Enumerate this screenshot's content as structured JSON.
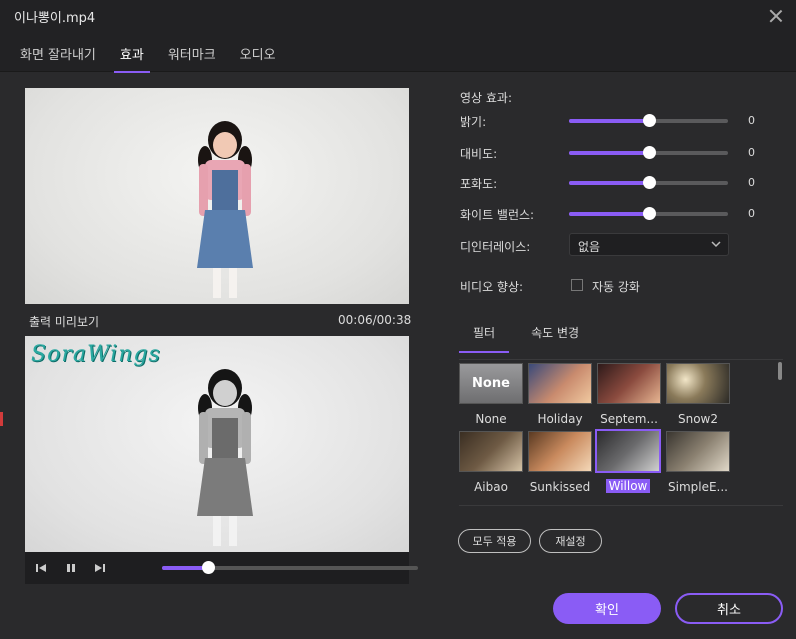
{
  "window": {
    "title": "이나뽕이.mp4"
  },
  "tabs": [
    {
      "label": "화면 잘라내기",
      "active": false
    },
    {
      "label": "효과",
      "active": true
    },
    {
      "label": "워터마크",
      "active": false
    },
    {
      "label": "오디오",
      "active": false
    }
  ],
  "preview": {
    "output_label": "출력 미리보기",
    "time": "00:06/00:38",
    "watermark_text": "SoraWings",
    "playback_progress": 0.18
  },
  "effects": {
    "section_title": "영상 효과:",
    "sliders": [
      {
        "label": "밝기:",
        "value": "0",
        "position": 0.5
      },
      {
        "label": "대비도:",
        "value": "0",
        "position": 0.5
      },
      {
        "label": "포화도:",
        "value": "0",
        "position": 0.5
      },
      {
        "label": "화이트 밸런스:",
        "value": "0",
        "position": 0.5
      }
    ],
    "deinterlace_label": "디인터레이스:",
    "deinterlace_value": "없음",
    "enhance_label": "비디오 향상:",
    "enhance_checkbox_label": "자동 강화",
    "enhance_checked": false
  },
  "filter_tabs": [
    {
      "label": "필터",
      "active": true
    },
    {
      "label": "속도 변경",
      "active": false
    }
  ],
  "filters": [
    {
      "name": "None",
      "selected": false,
      "thumb_text": "None"
    },
    {
      "name": "Holiday",
      "selected": false
    },
    {
      "name": "Septem...",
      "selected": false
    },
    {
      "name": "Snow2",
      "selected": false
    },
    {
      "name": "Aibao",
      "selected": false
    },
    {
      "name": "Sunkissed",
      "selected": false
    },
    {
      "name": "Willow",
      "selected": true
    },
    {
      "name": "SimpleE...",
      "selected": false
    }
  ],
  "buttons": {
    "apply_all": "모두 적용",
    "reset": "재설정",
    "ok": "확인",
    "cancel": "취소"
  },
  "colors": {
    "accent": "#8a5cf5",
    "background": "#2a2a2c"
  }
}
